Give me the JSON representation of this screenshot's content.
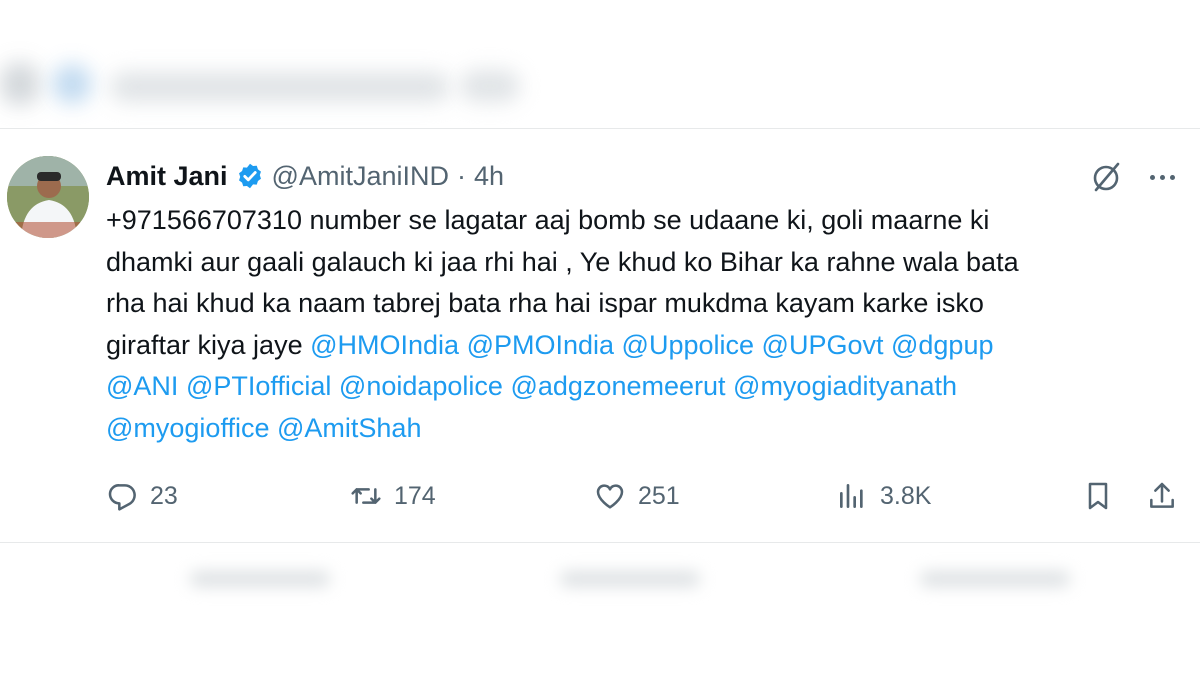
{
  "tweet": {
    "author_name": "Amit Jani",
    "handle": "@AmitJaniIND",
    "separator": "·",
    "time": "4h",
    "text_lines": [
      "+971566707310 number se lagatar aaj bomb se udaane ki, goli maarne ki",
      "dhamki aur gaali galauch ki jaa rhi hai , Ye khud ko Bihar ka rahne wala bata",
      "rha hai khud ka naam tabrej bata rha hai ispar mukdma kayam karke isko",
      "giraftar kiya jaye "
    ],
    "mentions": [
      "@HMOIndia",
      "@PMOIndia",
      "@Uppolice",
      "@UPGovt",
      "@dgpup",
      "@ANI",
      "@PTIofficial",
      "@noidapolice",
      "@adgzonemeerut",
      "@myogiadityanath",
      "@myogioffice",
      "@AmitShah"
    ]
  },
  "actions": {
    "reply_count": "23",
    "retweet_count": "174",
    "like_count": "251",
    "views_count": "3.8K"
  },
  "icons": {
    "verified": "verified-badge-icon",
    "grok": "grok-icon",
    "more": "more-dots-icon",
    "reply": "reply-icon",
    "retweet": "retweet-icon",
    "like": "heart-icon",
    "views": "views-icon",
    "bookmark": "bookmark-icon",
    "share": "share-icon"
  },
  "colors": {
    "text": "#0f1419",
    "secondary": "#536471",
    "link": "#1d9bf0",
    "divider": "#e7e9ea"
  }
}
